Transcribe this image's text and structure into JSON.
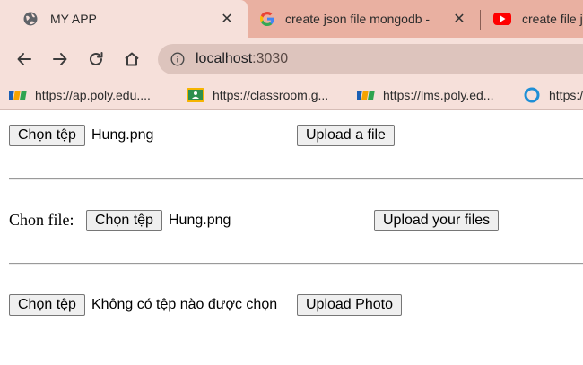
{
  "tabs": [
    {
      "title": "MY APP",
      "icon": "globe-icon",
      "close": "✕"
    },
    {
      "title": "create json file mongodb - ",
      "icon": "google-icon",
      "close": "✕"
    },
    {
      "title": "create file j",
      "icon": "youtube-icon"
    }
  ],
  "address": {
    "host": "localhost",
    "port": ":3030"
  },
  "bookmarks": [
    {
      "label": "https://ap.poly.edu....",
      "icon": "fpt-icon"
    },
    {
      "label": "https://classroom.g...",
      "icon": "classroom-icon"
    },
    {
      "label": "https://lms.poly.ed...",
      "icon": "fpt-icon"
    },
    {
      "label": "https:/",
      "icon": "circle-icon"
    }
  ],
  "forms": {
    "form1": {
      "choose_label": "Chọn tệp",
      "file_name": "Hung.png",
      "submit": "Upload a file"
    },
    "form2": {
      "label": "Chon file:",
      "choose_label": "Chọn tệp",
      "file_name": "Hung.png",
      "submit": "Upload your files"
    },
    "form3": {
      "choose_label": "Chọn tệp",
      "file_name": "Không có tệp nào được chọn",
      "submit": "Upload Photo"
    }
  },
  "colors": {
    "tabstrip": "#e9b0a1",
    "toolbar": "#f6e0da",
    "omnibox": "#ddc4bd"
  }
}
